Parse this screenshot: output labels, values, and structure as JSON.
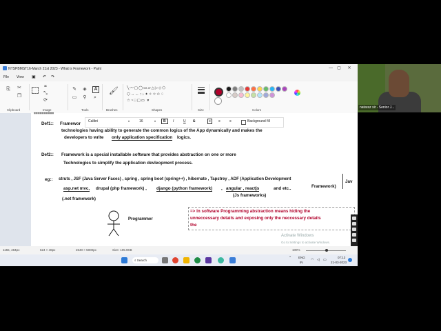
{
  "window": {
    "title": "NTSPBMST16-March 21st 2023 - What is Framework - Paint",
    "controls": [
      "—",
      "▢",
      "✕"
    ]
  },
  "menu": {
    "file": "File",
    "view": "View"
  },
  "ribbon": {
    "groups": {
      "clipboard": "Clipboard",
      "image": "Image",
      "tools": "Tools",
      "brushes": "Brushes",
      "shapes": "Shapes",
      "size": "Size",
      "colors": "Colors"
    },
    "palette": [
      "#1a1a1a",
      "#7f7f7f",
      "#c0c0c0",
      "#e53935",
      "#ff7043",
      "#ffd54f",
      "#66bb6a",
      "#29b6f6",
      "#3f51b5",
      "#ab47bc",
      "#ffffff",
      "#d7ccc8",
      "#f8bbd0",
      "#fff59d",
      "#c5e1a5",
      "#b3e5fc",
      "#9fa8da",
      "#ce93d8"
    ],
    "primary_color": "#b0002a"
  },
  "fontbar": {
    "font": "Calibri",
    "size": "16",
    "bold": "B",
    "italic": "I",
    "underline": "U",
    "strike": "S",
    "bg_fill": "Background fill"
  },
  "canvas": {
    "hash_line": "==========",
    "def1_label": "Def1::",
    "def1_l1": "Framewor",
    "def1_l2": "technologies having ability to generate the common logics of the App dynamically and makes the",
    "def1_l3a": "developers  to write ",
    "def1_l3b": "only  application specification",
    "def1_l3c": " logics.",
    "def2_label": "Def2::",
    "def2_l1": "Framework  is  a special installable software   that  provides abstraction on one or more",
    "def2_l2": "Technologies to simplify the application devleopment  process.",
    "eg_label": "eg::",
    "eg_l1": "struts  ,  JSF (Java Server Faces) ,   spring , spring  boot (spring++) ,  hibernate , Tapstrey  , ADF (Application Development",
    "eg_l1_end": "Framework)",
    "eg_jav": "Jav",
    "eg_l2a": "asp.net mvc,",
    "eg_l2b": "drupal (php framework)  ,",
    "eg_l2c": "django (python framework)",
    "eg_l2d": ",",
    "eg_l2e": "angular ,  reactjs",
    "eg_l2f": "and etc..",
    "eg_l3": "(.net framework)",
    "eg_js": "(Js frameworks)",
    "programmer": "Programmer",
    "abstraction_l1": "=>   In software Programming  abstraction means  hiding the",
    "abstraction_l2": "unneccessary details  and exposing only the neccessary details",
    "abstraction_l3": "the"
  },
  "status": {
    "cursor": "1155, 484px",
    "selection": "624 × 48px",
    "canvas_size": "2640 × 5000px",
    "file_size": "Size: 105.9KB",
    "zoom": "100%"
  },
  "activation": {
    "title": "Activate Windows",
    "subtitle": "Go to Settings to activate Windows."
  },
  "taskbar": {
    "search": "Search",
    "lang": "ENG",
    "region": "IN",
    "time": "07:13",
    "date": "21-03-2023"
  },
  "video": {
    "name": "nataraz sir - Senior J..."
  }
}
